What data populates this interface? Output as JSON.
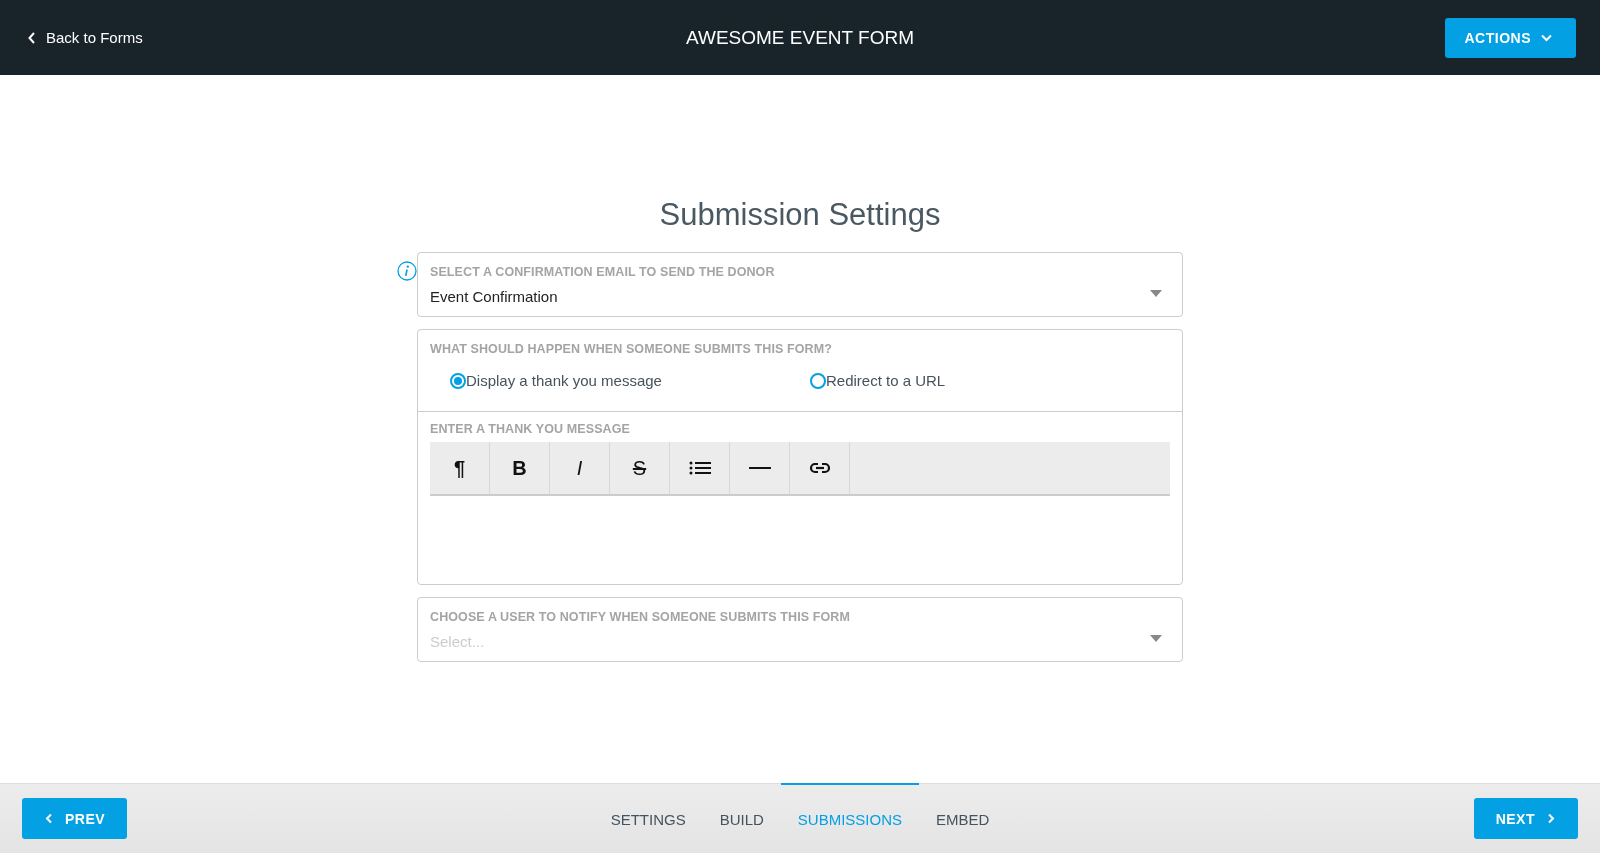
{
  "header": {
    "back_link": "Back to Forms",
    "title": "AWESOME EVENT FORM",
    "actions_button": "ACTIONS"
  },
  "page_title": "Submission Settings",
  "confirmation_email": {
    "label": "SELECT A CONFIRMATION EMAIL TO SEND THE DONOR",
    "value": "Event Confirmation"
  },
  "on_submit": {
    "label": "WHAT SHOULD HAPPEN WHEN SOMEONE SUBMITS THIS FORM?",
    "options": [
      {
        "label": "Display a thank you message",
        "selected": true
      },
      {
        "label": "Redirect to a URL",
        "selected": false
      }
    ]
  },
  "thank_you_message": {
    "label": "ENTER A THANK YOU MESSAGE",
    "toolbar": [
      {
        "kind": "paragraph",
        "label": "¶"
      },
      {
        "kind": "bold",
        "label": "B"
      },
      {
        "kind": "italic",
        "label": "I"
      },
      {
        "kind": "strike",
        "label": "S"
      },
      {
        "kind": "list"
      },
      {
        "kind": "rule"
      },
      {
        "kind": "link"
      }
    ]
  },
  "notify_user": {
    "label": "CHOOSE A USER TO NOTIFY WHEN SOMEONE SUBMITS THIS FORM",
    "placeholder": "Select..."
  },
  "footer": {
    "prev_button": "PREV",
    "next_button": "NEXT",
    "tabs": [
      {
        "label": "SETTINGS",
        "selected": false
      },
      {
        "label": "BUILD",
        "selected": false
      },
      {
        "label": "SUBMISSIONS",
        "selected": true
      },
      {
        "label": "EMBED",
        "selected": false
      }
    ]
  }
}
